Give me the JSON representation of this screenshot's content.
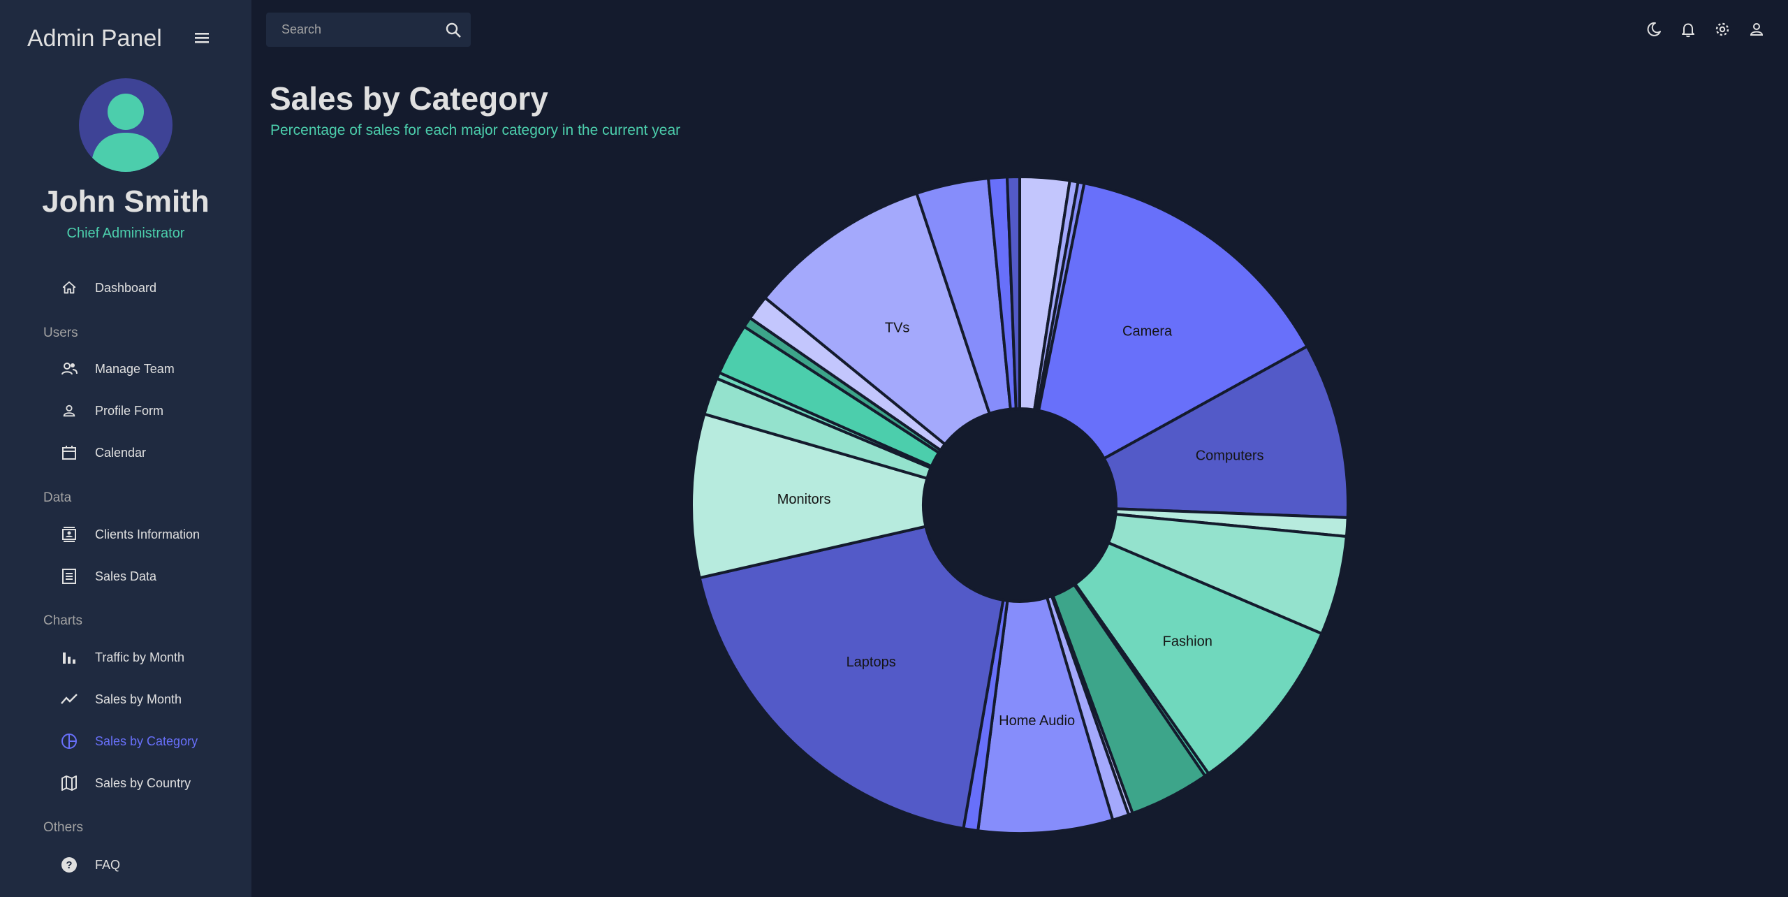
{
  "sidebar": {
    "brand": "Admin Panel",
    "user": {
      "name": "John Smith",
      "role": "Chief Administrator"
    },
    "sections": {
      "users": "Users",
      "data": "Data",
      "charts": "Charts",
      "others": "Others"
    },
    "items": [
      {
        "label": "Dashboard",
        "icon": "home-icon"
      },
      {
        "label": "Manage Team",
        "icon": "people-icon"
      },
      {
        "label": "Profile Form",
        "icon": "person-icon"
      },
      {
        "label": "Calendar",
        "icon": "calendar-icon"
      },
      {
        "label": "Clients Information",
        "icon": "contacts-icon"
      },
      {
        "label": "Sales Data",
        "icon": "receipt-icon"
      },
      {
        "label": "Traffic by Month",
        "icon": "bar-chart-icon"
      },
      {
        "label": "Sales by Month",
        "icon": "line-chart-icon"
      },
      {
        "label": "Sales by Category",
        "icon": "pie-chart-icon",
        "active": true
      },
      {
        "label": "Sales by Country",
        "icon": "map-icon"
      },
      {
        "label": "FAQ",
        "icon": "help-icon"
      }
    ]
  },
  "topbar": {
    "search_placeholder": "Search",
    "icons": [
      "dark-mode-icon",
      "notifications-icon",
      "settings-icon",
      "account-icon"
    ]
  },
  "header": {
    "title": "Sales by Category",
    "subtitle": "Percentage of sales for each major category in the current year"
  },
  "colors": {
    "background": "#141b2d",
    "panel": "#1f2a40",
    "accent_green": "#4cceac",
    "accent_blue": "#6870fa",
    "text": "#e0e0e0"
  },
  "chart_data": {
    "type": "pie",
    "donut": true,
    "slices": [
      {
        "label": "",
        "value": 2.4,
        "color": "#c3c6fd"
      },
      {
        "label": "",
        "value": 0.4,
        "color": "#a4a9fc"
      },
      {
        "label": "",
        "value": 0.3,
        "color": "#868dfb"
      },
      {
        "label": "Camera",
        "value": 13.6,
        "color": "#6870fa"
      },
      {
        "label": "Computers",
        "value": 8.5,
        "color": "#535ac8"
      },
      {
        "label": "",
        "value": 0.9,
        "color": "#b7ebde"
      },
      {
        "label": "",
        "value": 4.8,
        "color": "#94e2cd"
      },
      {
        "label": "Fashion",
        "value": 8.7,
        "color": "#70d8bd"
      },
      {
        "label": "",
        "value": 0.2,
        "color": "#4cceac"
      },
      {
        "label": "",
        "value": 3.9,
        "color": "#3da58a"
      },
      {
        "label": "",
        "value": 0.2,
        "color": "#c3c6fd"
      },
      {
        "label": "",
        "value": 0.8,
        "color": "#a4a9fc"
      },
      {
        "label": "Home Audio",
        "value": 6.5,
        "color": "#868dfb"
      },
      {
        "label": "",
        "value": 0.7,
        "color": "#6870fa"
      },
      {
        "label": "Laptops",
        "value": 18.4,
        "color": "#535ac8"
      },
      {
        "label": "Monitors",
        "value": 7.9,
        "color": "#b7ebde"
      },
      {
        "label": "",
        "value": 1.8,
        "color": "#94e2cd"
      },
      {
        "label": "",
        "value": 0.3,
        "color": "#70d8bd"
      },
      {
        "label": "",
        "value": 2.5,
        "color": "#4cceac"
      },
      {
        "label": "",
        "value": 0.5,
        "color": "#3da58a"
      },
      {
        "label": "",
        "value": 1.2,
        "color": "#c3c6fd"
      },
      {
        "label": "TVs",
        "value": 8.9,
        "color": "#a4a9fc"
      },
      {
        "label": "",
        "value": 3.5,
        "color": "#868dfb"
      },
      {
        "label": "",
        "value": 0.9,
        "color": "#6870fa"
      },
      {
        "label": "",
        "value": 0.6,
        "color": "#535ac8"
      }
    ]
  }
}
